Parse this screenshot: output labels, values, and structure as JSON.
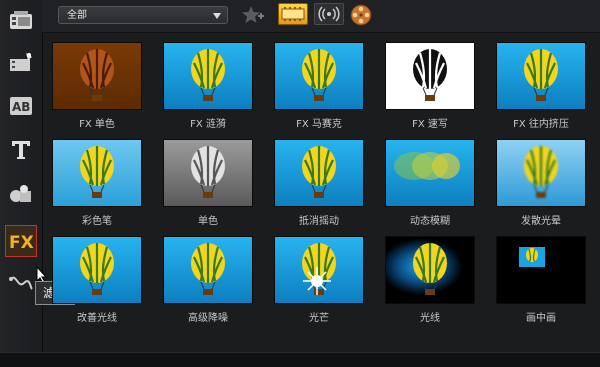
{
  "toolbar": {
    "category_select": "全部",
    "icons": [
      "filter-star-icon",
      "video-filter-icon",
      "audio-filter-icon",
      "film-reel-icon"
    ]
  },
  "sidebar": {
    "tools": [
      "media-icon",
      "transition-icon",
      "title-ab-icon",
      "text-icon",
      "graphic-icon",
      "fx-filter-icon",
      "motion-path-icon"
    ],
    "active_tool": "fx-filter-icon",
    "tooltip": "滤镜"
  },
  "filters": [
    {
      "label": "FX 单色",
      "style": "brown"
    },
    {
      "label": "FX 涟漪",
      "style": "normal"
    },
    {
      "label": "FX 马赛克",
      "style": "normal"
    },
    {
      "label": "FX 速写",
      "style": "sketch"
    },
    {
      "label": "FX 往内挤压",
      "style": "normal"
    },
    {
      "label": "彩色笔",
      "style": "light"
    },
    {
      "label": "单色",
      "style": "gray"
    },
    {
      "label": "抵消摇动",
      "style": "normal"
    },
    {
      "label": "动态模糊",
      "style": "blur"
    },
    {
      "label": "发散光晕",
      "style": "glow"
    },
    {
      "label": "改善光线",
      "style": "normal"
    },
    {
      "label": "高级降噪",
      "style": "normal"
    },
    {
      "label": "光芒",
      "style": "flare"
    },
    {
      "label": "光线",
      "style": "spot"
    },
    {
      "label": "画中画",
      "style": "pip"
    }
  ],
  "colors": {
    "accent": "#e3a21a",
    "active_border": "#c7302f",
    "sky": "#1aa3e0"
  }
}
